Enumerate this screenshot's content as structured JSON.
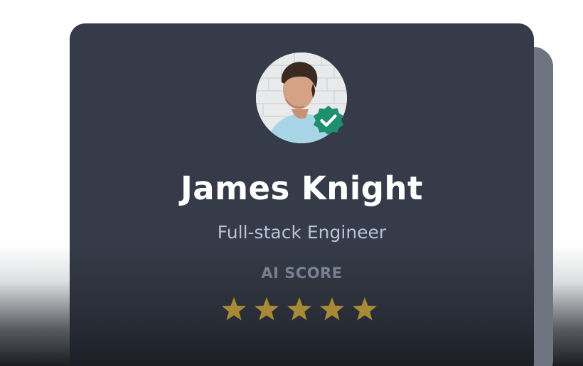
{
  "profile": {
    "name": "James Knight",
    "role": "Full-stack Engineer",
    "score_label": "AI SCORE",
    "verified": true
  },
  "rating": {
    "value": 5,
    "max": 5
  },
  "icons": {
    "badge": "verified-check-icon",
    "star": "star-icon"
  },
  "colors": {
    "card_background": "#353b48",
    "back_card": "#6f7580",
    "name_text": "#ffffff",
    "role_text": "#b8c2d3",
    "score_label_text": "#8f9aac",
    "badge": "#1f8f6f",
    "star": "#a88a36"
  }
}
